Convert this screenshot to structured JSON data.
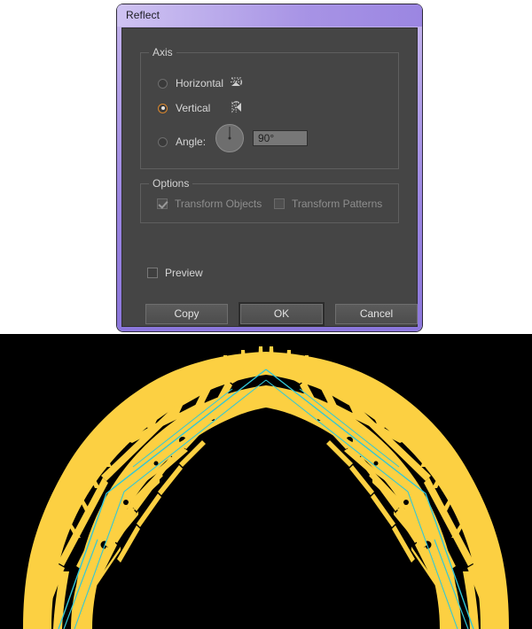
{
  "window": {
    "title": "Reflect"
  },
  "axis": {
    "group_label": "Axis",
    "options": [
      {
        "label": "Horizontal",
        "selected": false,
        "icon": "reflect-horizontal-icon"
      },
      {
        "label": "Vertical",
        "selected": true,
        "icon": "reflect-vertical-icon"
      },
      {
        "label": "Angle:",
        "selected": false,
        "icon": "angle-dial-icon"
      }
    ],
    "angle_value": "90°",
    "angle_dial_degrees": 90,
    "selected_radio_color": "#d9872e"
  },
  "options": {
    "group_label": "Options",
    "checkboxes": [
      {
        "label": "Transform Objects",
        "checked": true,
        "enabled": false
      },
      {
        "label": "Transform Patterns",
        "checked": false,
        "enabled": false
      }
    ]
  },
  "preview": {
    "label": "Preview",
    "checked": false,
    "enabled": true
  },
  "buttons": [
    {
      "label": "Copy",
      "default": false
    },
    {
      "label": "OK",
      "default": true
    },
    {
      "label": "Cancel",
      "default": false
    }
  ],
  "canvas": {
    "background_color": "#000000",
    "artwork_color": "#FCD042",
    "guide_color": "#33C7D6",
    "description": "symmetric yellow filigree arch artwork with cyan guide lines"
  },
  "theme": {
    "dialog_frame_purple": "#9b86e2",
    "dialog_body_gray": "#454545",
    "page_background": "#ffffff"
  }
}
